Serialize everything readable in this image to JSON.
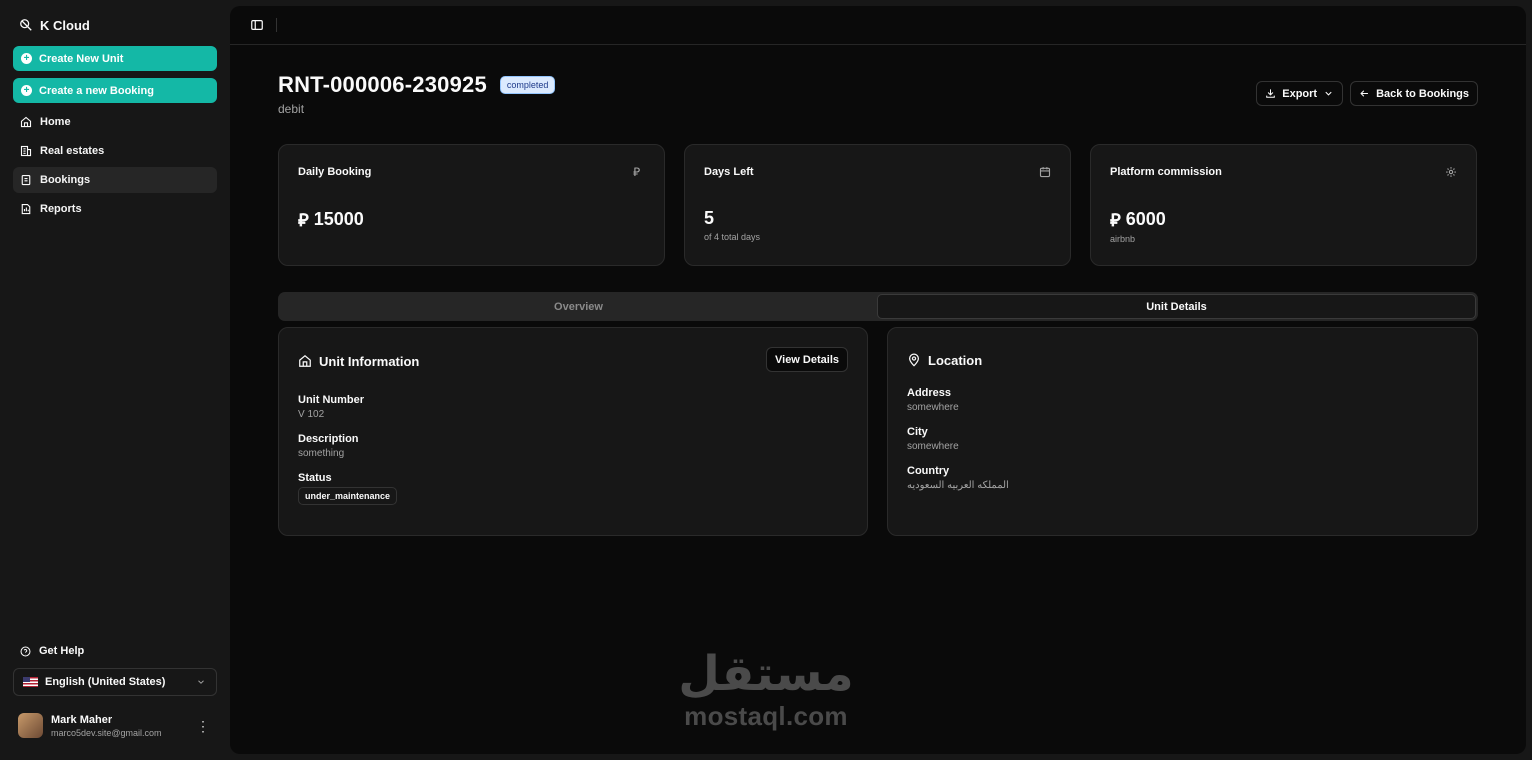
{
  "app": {
    "title": "K Cloud"
  },
  "sidebar": {
    "actions": [
      {
        "label": "Create New Unit"
      },
      {
        "label": "Create a new Booking"
      }
    ],
    "items": [
      {
        "label": "Home",
        "icon": "home-icon"
      },
      {
        "label": "Real estates",
        "icon": "building-icon"
      },
      {
        "label": "Bookings",
        "icon": "receipt-icon",
        "active": true
      },
      {
        "label": "Reports",
        "icon": "report-icon"
      }
    ],
    "help": "Get Help",
    "language": "English (United States)",
    "user": {
      "name": "Mark Maher",
      "email": "marco5dev.site@gmail.com"
    }
  },
  "header": {
    "title": "RNT-000006-230925",
    "status": "completed",
    "subtitle": "debit",
    "export_label": "Export",
    "back_label": "Back to Bookings"
  },
  "stats": [
    {
      "label": "Daily Booking",
      "value": "15000",
      "currency": "⃁",
      "sub": ""
    },
    {
      "label": "Days Left",
      "value": "5",
      "sub": "of 4 total days"
    },
    {
      "label": "Platform commission",
      "value": "6000",
      "currency": "⃁",
      "sub": "airbnb"
    }
  ],
  "tabs": [
    {
      "label": "Overview",
      "active": false
    },
    {
      "label": "Unit Details",
      "active": true
    }
  ],
  "unit": {
    "title": "Unit Information",
    "view_details": "View Details",
    "number_label": "Unit Number",
    "number": "V 102",
    "description_label": "Description",
    "description": "something",
    "status_label": "Status",
    "status": "under_maintenance"
  },
  "location": {
    "title": "Location",
    "address_label": "Address",
    "address": "somewhere",
    "city_label": "City",
    "city": "somewhere",
    "country_label": "Country",
    "country": "المملكه العربيه السعوديه"
  },
  "watermark": {
    "arabic": "مستقل",
    "latin": "mostaql.com"
  },
  "colors": {
    "accent": "#14b8a6",
    "badge_bg": "#dbeafe",
    "badge_text": "#1e3a8a"
  }
}
